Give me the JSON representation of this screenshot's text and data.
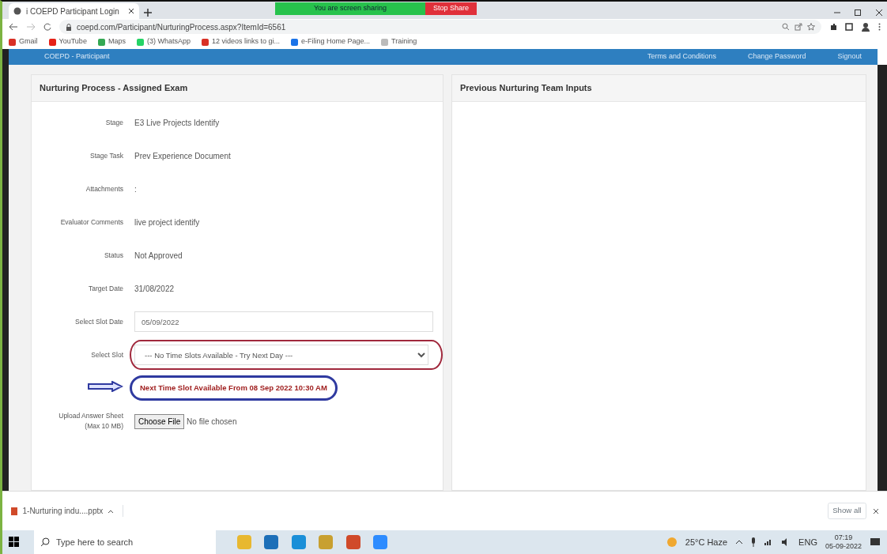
{
  "browser": {
    "tab_title": "i COEPD Participant Login",
    "screen_share": {
      "message": "You are screen sharing",
      "stop": "Stop Share"
    },
    "url": "coepd.com/Participant/NurturingProcess.aspx?ItemId=6561",
    "bookmarks": [
      {
        "label": "Gmail",
        "color": "#d93025"
      },
      {
        "label": "YouTube",
        "color": "#e62117"
      },
      {
        "label": "Maps",
        "color": "#34a853"
      },
      {
        "label": "(3) WhatsApp",
        "color": "#25d366"
      },
      {
        "label": "12 videos links to gi...",
        "color": "#d93025"
      },
      {
        "label": "e-Filing Home Page...",
        "color": "#1a73e8"
      },
      {
        "label": "Training",
        "color": "#bbbbbb"
      }
    ]
  },
  "navbar": {
    "brand": "COEPD - Participant",
    "links": [
      "Terms and Conditions",
      "Change Password",
      "Signout"
    ]
  },
  "left_panel": {
    "title": "Nurturing Process - Assigned Exam",
    "fields": [
      {
        "kind": "text",
        "label": "Stage",
        "value": "E3 Live Projects Identify"
      },
      {
        "kind": "text",
        "label": "Stage Task",
        "value": "Prev Experience Document"
      },
      {
        "kind": "text",
        "label": "Attachments",
        "value": ":"
      },
      {
        "kind": "text",
        "label": "Evaluator Comments",
        "value": "live project identify"
      },
      {
        "kind": "text",
        "label": "Status",
        "value": "Not Approved"
      },
      {
        "kind": "text",
        "label": "Target Date",
        "value": "31/08/2022"
      },
      {
        "kind": "input",
        "label": "Select Slot Date",
        "value": "05/09/2022"
      },
      {
        "kind": "select",
        "label": "Select Slot",
        "value": "--- No Time Slots Available - Try Next Day ---"
      },
      {
        "kind": "message",
        "value": "Next Time Slot Available From 08 Sep 2022 10:30 AM"
      },
      {
        "kind": "file",
        "label": "Upload Answer Sheet",
        "sublabel": "(Max 10 MB)",
        "button": "Choose File",
        "value": "No file chosen"
      }
    ]
  },
  "right_panel": {
    "title": "Previous Nurturing Team Inputs"
  },
  "download_bar": {
    "file": "1-Nurturing indu....pptx",
    "show_all": "Show all"
  },
  "taskbar": {
    "search_placeholder": "Type here to search",
    "weather": "25°C  Haze",
    "language": "ENG",
    "time": "07:19",
    "date": "05-09-2022"
  }
}
